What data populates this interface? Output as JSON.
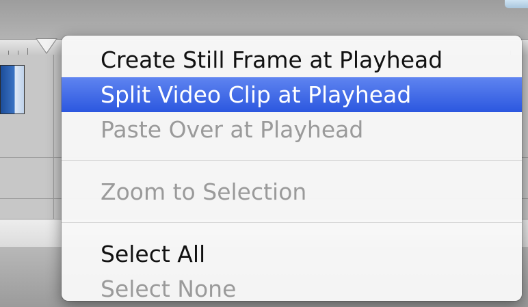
{
  "context_menu": {
    "groups": [
      {
        "items": [
          {
            "label": "Create Still Frame at Playhead",
            "state": "enabled"
          },
          {
            "label": "Split Video Clip at Playhead",
            "state": "highlighted"
          },
          {
            "label": "Paste Over at Playhead",
            "state": "disabled"
          }
        ]
      },
      {
        "items": [
          {
            "label": "Zoom to Selection",
            "state": "disabled"
          }
        ]
      },
      {
        "items": [
          {
            "label": "Select All",
            "state": "enabled"
          },
          {
            "label": "Select None",
            "state": "disabled"
          }
        ]
      }
    ]
  },
  "colors": {
    "highlight": "#3a63e6",
    "text_enabled": "#111111",
    "text_disabled": "#9a9a9a",
    "menu_background": "#f7f7f7"
  }
}
